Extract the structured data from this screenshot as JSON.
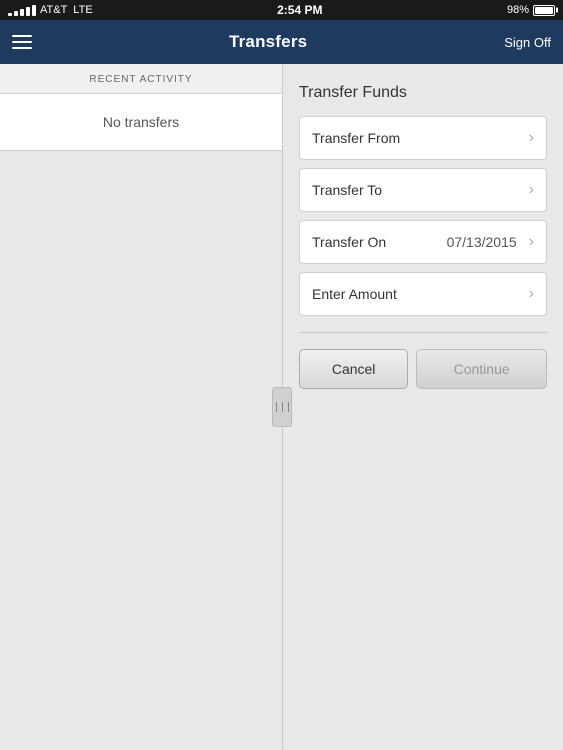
{
  "statusBar": {
    "carrier": "AT&T",
    "networkType": "LTE",
    "time": "2:54 PM",
    "batteryPercent": "98%"
  },
  "navBar": {
    "title": "Transfers",
    "signOffLabel": "Sign Off"
  },
  "leftPanel": {
    "recentActivityLabel": "RECENT ACTIVITY",
    "noTransfersLabel": "No transfers"
  },
  "rightPanel": {
    "transferFundsTitle": "Transfer Funds",
    "form": {
      "transferFromLabel": "Transfer From",
      "transferToLabel": "Transfer To",
      "transferOnLabel": "Transfer On",
      "transferOnValue": "07/13/2015",
      "enterAmountLabel": "Enter Amount"
    },
    "buttons": {
      "cancelLabel": "Cancel",
      "continueLabel": "Continue"
    }
  }
}
